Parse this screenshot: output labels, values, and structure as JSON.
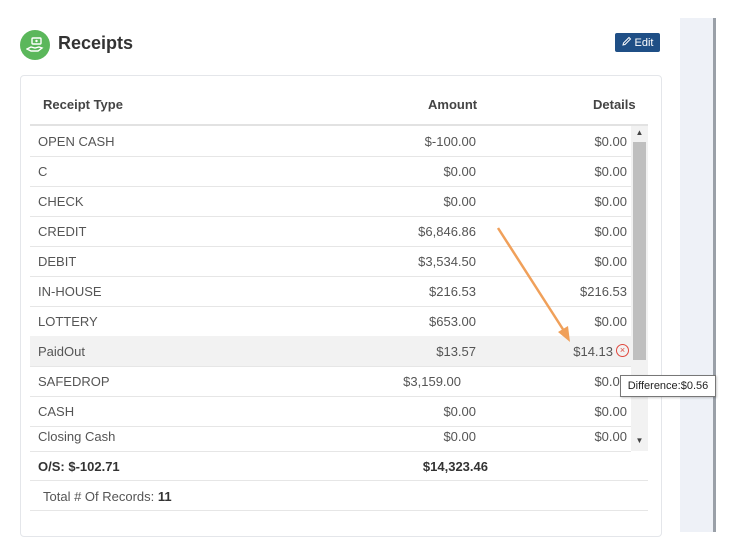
{
  "header": {
    "title": "Receipts",
    "icon": "money-hand-icon",
    "edit_label": "Edit"
  },
  "table": {
    "columns": {
      "type": "Receipt Type",
      "amount": "Amount",
      "details": "Details"
    },
    "rows": [
      {
        "type": "OPEN CASH",
        "amount": "$-100.00",
        "details": "$0.00"
      },
      {
        "type": "C",
        "amount": "$0.00",
        "details": "$0.00"
      },
      {
        "type": "CHECK",
        "amount": "$0.00",
        "details": "$0.00"
      },
      {
        "type": "CREDIT",
        "amount": "$6,846.86",
        "details": "$0.00"
      },
      {
        "type": "DEBIT",
        "amount": "$3,534.50",
        "details": "$0.00"
      },
      {
        "type": "IN-HOUSE",
        "amount": "$216.53",
        "details": "$216.53"
      },
      {
        "type": "LOTTERY",
        "amount": "$653.00",
        "details": "$0.00"
      },
      {
        "type": "PaidOut",
        "amount": "$13.57",
        "details": "$14.13"
      },
      {
        "type": "SAFEDROP",
        "amount": "$3,159.00",
        "details": "$0.00"
      },
      {
        "type": "CASH",
        "amount": "$0.00",
        "details": "$0.00"
      },
      {
        "type": "Closing Cash",
        "amount": "$0.00",
        "details": "$0.00"
      }
    ],
    "summary": {
      "os": "O/S: $-102.71",
      "total": "$14,323.46"
    },
    "records_label": "Total # Of Records:",
    "records_count": "11"
  },
  "tooltip": {
    "text": "Difference:$0.56"
  },
  "colors": {
    "accent": "#5bb75b",
    "edit_button": "#1f4f86",
    "error": "#e0483e",
    "arrow": "#f0a05a"
  }
}
